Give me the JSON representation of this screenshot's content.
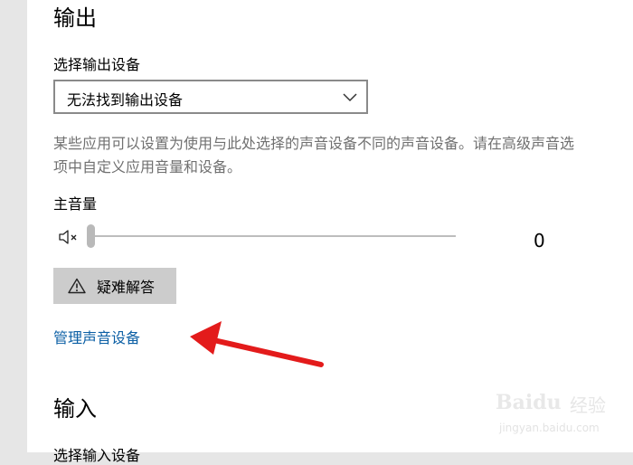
{
  "output": {
    "title": "输出",
    "device_label": "选择输出设备",
    "device_value": "无法找到输出设备",
    "description": "某些应用可以设置为使用与此处选择的声音设备不同的声音设备。请在高级声音选项中自定义应用音量和设备。",
    "master_volume_label": "主音量",
    "master_volume_value": "0",
    "troubleshoot_label": "疑难解答",
    "manage_devices_link": "管理声音设备"
  },
  "input": {
    "title": "输入",
    "device_label": "选择输入设备"
  },
  "icons": {
    "volume": "speaker-muted-icon",
    "warning": "warning-icon",
    "chevron": "chevron-down-icon"
  },
  "annotation": {
    "arrow_color": "#e31b1b"
  },
  "watermark": {
    "logo": "Baidu",
    "cn": "经验",
    "url": "jingyan.baidu.com"
  },
  "colors": {
    "link": "#0b5fa5",
    "description": "#707070",
    "button_bg": "#cccccc"
  }
}
